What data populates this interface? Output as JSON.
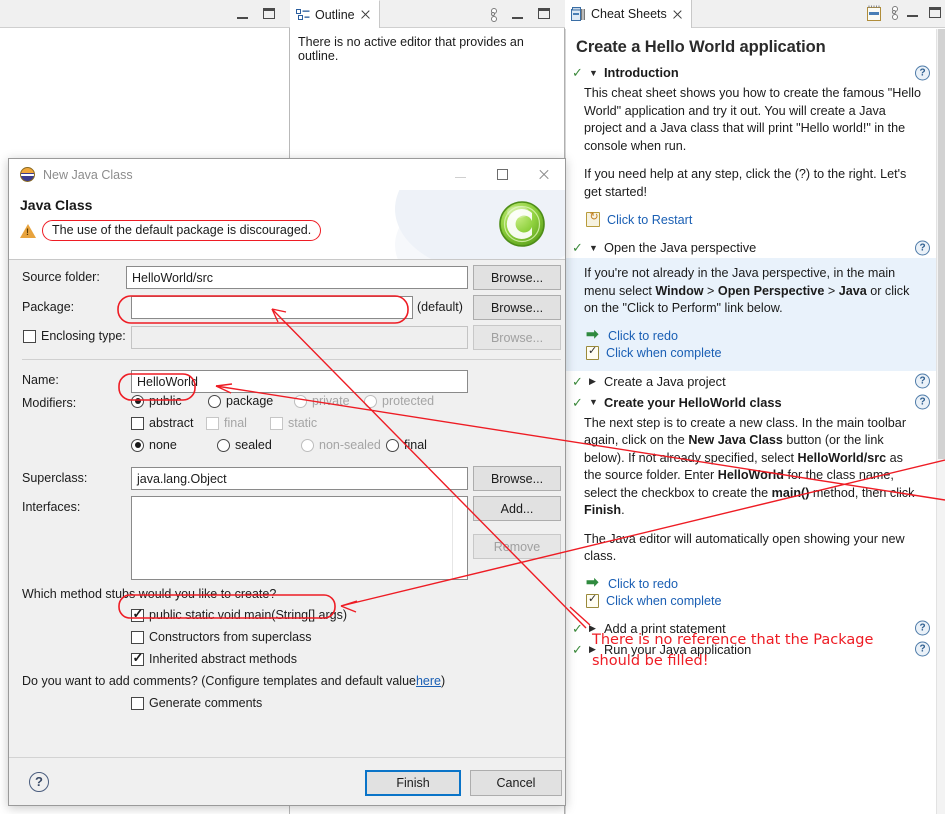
{
  "workbench": {
    "left_view": {
      "minimize_tooltip": "Minimize",
      "maximize_tooltip": "Maximize"
    },
    "outline": {
      "tab_label": "Outline",
      "message": "There is no active editor that provides an outline.",
      "icon": "outline-icon",
      "close_icon": "close-icon"
    }
  },
  "cheatsheet": {
    "tab_label": "Cheat Sheets",
    "tab_icon": "cheatsheet-icon",
    "toolbar": [
      {
        "name": "cheatsheet-notebook-icon",
        "label": ""
      },
      {
        "name": "view-menu-icon",
        "label": ""
      },
      {
        "name": "minimize-icon",
        "label": ""
      },
      {
        "name": "maximize-icon",
        "label": ""
      }
    ],
    "title": "Create a Hello World application",
    "sections": [
      {
        "id": "introduction",
        "title": "Introduction",
        "bold": true,
        "expanded": true,
        "checked": true,
        "help": "?",
        "paragraphs": [
          "This cheat sheet shows you how to create the famous \"Hello World\" application and try it out. You will create a Java project and a Java class that will print \"Hello world!\" in the console when run.",
          "If you need help at any step, click the (?) to the right. Let's get started!"
        ],
        "links": [
          {
            "icon": "restart-icon",
            "label": "Click to Restart"
          }
        ],
        "highlight": false
      },
      {
        "id": "open-java-perspective",
        "title": "Open the Java perspective",
        "bold": false,
        "expanded": true,
        "checked": true,
        "help": "?",
        "paragraphs_html": [
          "If you're not already in the Java perspective, in the main menu select <b>Window</b> &gt; <b>Open Perspective</b> &gt; <b>Java</b> or click on the \"Click to Perform\" link below."
        ],
        "links": [
          {
            "icon": "redo-icon",
            "label": "Click to redo"
          },
          {
            "icon": "complete-icon",
            "label": "Click when complete"
          }
        ],
        "highlight": true
      },
      {
        "id": "create-java-project",
        "title": "Create a Java project",
        "bold": false,
        "expanded": false,
        "checked": true,
        "help": "?",
        "paragraphs_html": [],
        "links": [],
        "highlight": false
      },
      {
        "id": "create-helloworld-class",
        "title": "Create your HelloWorld class",
        "bold": true,
        "expanded": true,
        "checked": true,
        "help": "?",
        "paragraphs_html": [
          "The next step is to create a new class. In the main toolbar again, click on the <b>New Java Class</b> button (or the link below). If not already specified, select <b>HelloWorld/src</b> as the source folder. Enter <b>HelloWorld</b> for the class name, select the checkbox to create the <b>main()</b> method, then click <b>Finish</b>.",
          "The Java editor will automatically open showing your new class."
        ],
        "links": [
          {
            "icon": "redo-icon",
            "label": "Click to redo"
          },
          {
            "icon": "complete-icon",
            "label": "Click when complete"
          }
        ],
        "highlight": false
      },
      {
        "id": "add-print-statement",
        "title": "Add a print statement",
        "bold": false,
        "expanded": false,
        "checked": true,
        "help": "?",
        "paragraphs_html": [],
        "links": [],
        "highlight": false
      },
      {
        "id": "run-java-application",
        "title": "Run your Java application",
        "bold": false,
        "expanded": false,
        "checked": true,
        "help": "?",
        "paragraphs_html": [],
        "links": [],
        "highlight": false
      }
    ]
  },
  "dialog": {
    "window_title": "New Java Class",
    "window_icon": "java-class-icon",
    "minimize_label": "",
    "maximize_label": "",
    "close_label": "",
    "header_title": "Java Class",
    "warning_message": "The use of the default package is discouraged.",
    "logo": "eclipse-wizard-logo",
    "fields": {
      "source_folder": {
        "label": "Source folder:",
        "value": "HelloWorld/src",
        "browse": "Browse..."
      },
      "package": {
        "label": "Package:",
        "value": "",
        "suffix": "(default)",
        "browse": "Browse..."
      },
      "enclosing_type": {
        "label": "Enclosing type:",
        "checked": false,
        "value": "",
        "browse": "Browse...",
        "disabled": true
      },
      "name": {
        "label": "Name:",
        "value": "HelloWorld"
      },
      "superclass": {
        "label": "Superclass:",
        "value": "java.lang.Object",
        "browse": "Browse..."
      },
      "interfaces": {
        "label": "Interfaces:",
        "add": "Add...",
        "remove": "Remove",
        "items": []
      }
    },
    "modifiers": {
      "label": "Modifiers:",
      "access": [
        {
          "label": "public",
          "selected": true,
          "disabled": false
        },
        {
          "label": "package",
          "selected": false,
          "disabled": false
        },
        {
          "label": "private",
          "selected": false,
          "disabled": true
        },
        {
          "label": "protected",
          "selected": false,
          "disabled": true
        }
      ],
      "flags": [
        {
          "label": "abstract",
          "checked": false,
          "disabled": false
        },
        {
          "label": "final",
          "checked": false,
          "disabled": true
        },
        {
          "label": "static",
          "checked": false,
          "disabled": true
        }
      ],
      "sealed": [
        {
          "label": "none",
          "selected": true,
          "disabled": false
        },
        {
          "label": "sealed",
          "selected": false,
          "disabled": false
        },
        {
          "label": "non-sealed",
          "selected": false,
          "disabled": true
        },
        {
          "label": "final",
          "selected": false,
          "disabled": false
        }
      ]
    },
    "stubs": {
      "question": "Which method stubs would you like to create?",
      "options": [
        {
          "label": "public static void main(String[] args)",
          "checked": true
        },
        {
          "label": "Constructors from superclass",
          "checked": false
        },
        {
          "label": "Inherited abstract methods",
          "checked": true
        }
      ]
    },
    "comments": {
      "question_prefix": "Do you want to add comments? (Configure templates and default value ",
      "link": "here",
      "question_suffix": ")",
      "option": {
        "label": "Generate comments",
        "checked": false
      }
    },
    "footer": {
      "help_icon": "?",
      "finish": "Finish",
      "cancel": "Cancel"
    }
  },
  "annotation": {
    "color": "#ee1c24",
    "note": "There is no reference that the Package should be filled!",
    "highlighted_fields": [
      "package",
      "name",
      "main-stub",
      "warning-message"
    ]
  }
}
